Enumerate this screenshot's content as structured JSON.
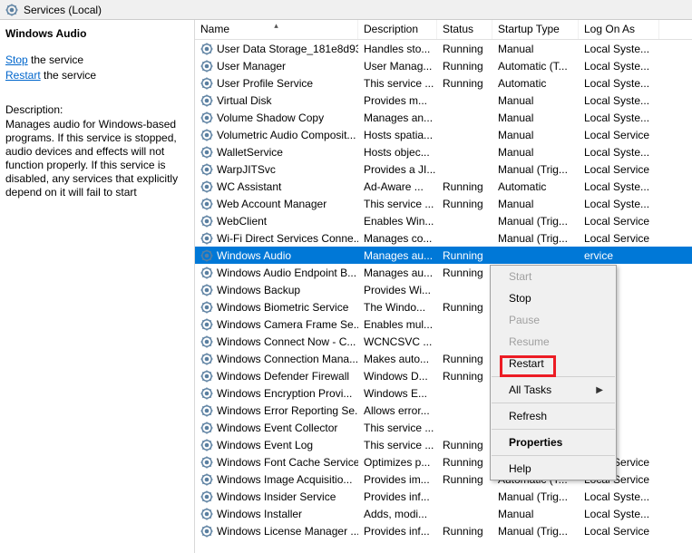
{
  "header": {
    "title": "Services (Local)"
  },
  "left": {
    "selected_name": "Windows Audio",
    "stop_link": "Stop",
    "stop_suffix": " the service",
    "restart_link": "Restart",
    "restart_suffix": " the service",
    "desc_label": "Description:",
    "desc_text": "Manages audio for Windows-based programs.  If this service is stopped, audio devices and effects will not function properly. If this service is disabled, any services that explicitly depend on it will fail to start"
  },
  "columns": {
    "name": "Name",
    "description": "Description",
    "status": "Status",
    "startup": "Startup Type",
    "logon": "Log On As"
  },
  "services": [
    {
      "name": "User Data Storage_181e8d93",
      "desc": "Handles sto...",
      "status": "Running",
      "startup": "Manual",
      "logon": "Local Syste..."
    },
    {
      "name": "User Manager",
      "desc": "User Manag...",
      "status": "Running",
      "startup": "Automatic (T...",
      "logon": "Local Syste..."
    },
    {
      "name": "User Profile Service",
      "desc": "This service ...",
      "status": "Running",
      "startup": "Automatic",
      "logon": "Local Syste..."
    },
    {
      "name": "Virtual Disk",
      "desc": "Provides m...",
      "status": "",
      "startup": "Manual",
      "logon": "Local Syste..."
    },
    {
      "name": "Volume Shadow Copy",
      "desc": "Manages an...",
      "status": "",
      "startup": "Manual",
      "logon": "Local Syste..."
    },
    {
      "name": "Volumetric Audio Composit...",
      "desc": "Hosts spatia...",
      "status": "",
      "startup": "Manual",
      "logon": "Local Service"
    },
    {
      "name": "WalletService",
      "desc": "Hosts objec...",
      "status": "",
      "startup": "Manual",
      "logon": "Local Syste..."
    },
    {
      "name": "WarpJITSvc",
      "desc": "Provides a JI...",
      "status": "",
      "startup": "Manual (Trig...",
      "logon": "Local Service"
    },
    {
      "name": "WC Assistant",
      "desc": "Ad-Aware ...",
      "status": "Running",
      "startup": "Automatic",
      "logon": "Local Syste..."
    },
    {
      "name": "Web Account Manager",
      "desc": "This service ...",
      "status": "Running",
      "startup": "Manual",
      "logon": "Local Syste..."
    },
    {
      "name": "WebClient",
      "desc": "Enables Win...",
      "status": "",
      "startup": "Manual (Trig...",
      "logon": "Local Service"
    },
    {
      "name": "Wi-Fi Direct Services Conne...",
      "desc": "Manages co...",
      "status": "",
      "startup": "Manual (Trig...",
      "logon": "Local Service"
    },
    {
      "name": "Windows Audio",
      "desc": "Manages au...",
      "status": "Running",
      "startup": "",
      "logon": "ervice",
      "selected": true
    },
    {
      "name": "Windows Audio Endpoint B...",
      "desc": "Manages au...",
      "status": "Running",
      "startup": "",
      "logon": "ste..."
    },
    {
      "name": "Windows Backup",
      "desc": "Provides Wi...",
      "status": "",
      "startup": "",
      "logon": "ste..."
    },
    {
      "name": "Windows Biometric Service",
      "desc": "The Windo...",
      "status": "Running",
      "startup": "",
      "logon": "ste..."
    },
    {
      "name": "Windows Camera Frame Se...",
      "desc": "Enables mul...",
      "status": "",
      "startup": "",
      "logon": "ste..."
    },
    {
      "name": "Windows Connect Now - C...",
      "desc": "WCNCSVC ...",
      "status": "",
      "startup": "",
      "logon": "ervice"
    },
    {
      "name": "Windows Connection Mana...",
      "desc": "Makes auto...",
      "status": "Running",
      "startup": "",
      "logon": "ste..."
    },
    {
      "name": "Windows Defender Firewall",
      "desc": "Windows D...",
      "status": "Running",
      "startup": "",
      "logon": "ervice"
    },
    {
      "name": "Windows Encryption Provi...",
      "desc": "Windows E...",
      "status": "",
      "startup": "",
      "logon": "ervice"
    },
    {
      "name": "Windows Error Reporting Se...",
      "desc": "Allows error...",
      "status": "",
      "startup": "",
      "logon": "ste..."
    },
    {
      "name": "Windows Event Collector",
      "desc": "This service ...",
      "status": "",
      "startup": "",
      "logon": "k S..."
    },
    {
      "name": "Windows Event Log",
      "desc": "This service ...",
      "status": "Running",
      "startup": "",
      "logon": "ervice"
    },
    {
      "name": "Windows Font Cache Service",
      "desc": "Optimizes p...",
      "status": "Running",
      "startup": "Automatic",
      "logon": "Local Service"
    },
    {
      "name": "Windows Image Acquisitio...",
      "desc": "Provides im...",
      "status": "Running",
      "startup": "Automatic (T...",
      "logon": "Local Service"
    },
    {
      "name": "Windows Insider Service",
      "desc": "Provides inf...",
      "status": "",
      "startup": "Manual (Trig...",
      "logon": "Local Syste..."
    },
    {
      "name": "Windows Installer",
      "desc": "Adds, modi...",
      "status": "",
      "startup": "Manual",
      "logon": "Local Syste..."
    },
    {
      "name": "Windows License Manager ...",
      "desc": "Provides inf...",
      "status": "Running",
      "startup": "Manual (Trig...",
      "logon": "Local Service"
    }
  ],
  "context_menu": {
    "items": [
      {
        "label": "Start",
        "disabled": true
      },
      {
        "label": "Stop"
      },
      {
        "label": "Pause",
        "disabled": true
      },
      {
        "label": "Resume",
        "disabled": true
      },
      {
        "label": "Restart",
        "highlight": true
      },
      {
        "sep": true
      },
      {
        "label": "All Tasks",
        "submenu": true
      },
      {
        "sep": true
      },
      {
        "label": "Refresh"
      },
      {
        "sep": true
      },
      {
        "label": "Properties",
        "bold": true
      },
      {
        "sep": true
      },
      {
        "label": "Help"
      }
    ]
  }
}
